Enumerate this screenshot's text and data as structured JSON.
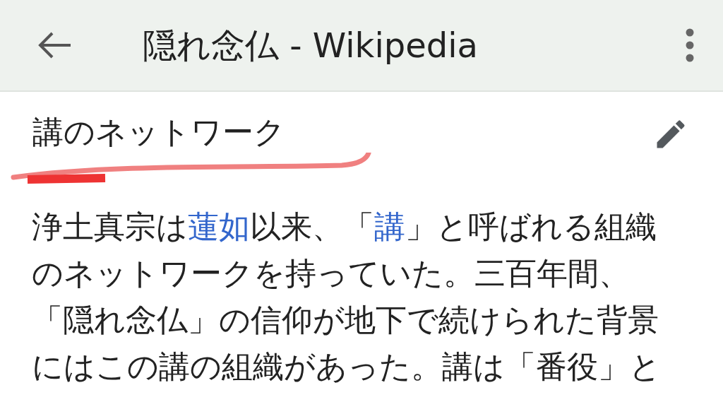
{
  "app_bar": {
    "title": "隠れ念仏 - Wikipedia"
  },
  "section": {
    "heading": "講のネットワーク",
    "paragraph": [
      {
        "text": "浄土真宗は",
        "link": false
      },
      {
        "text": "蓮如",
        "link": true
      },
      {
        "text": "以来、「",
        "link": false
      },
      {
        "text": "講",
        "link": true
      },
      {
        "text": "」と呼ばれる組織のネットワークを持っていた。三百年間、「隠れ念仏」の信仰が地下で続けられた背景にはこの講の組織があった。講は「番役」と",
        "link": false
      }
    ]
  }
}
